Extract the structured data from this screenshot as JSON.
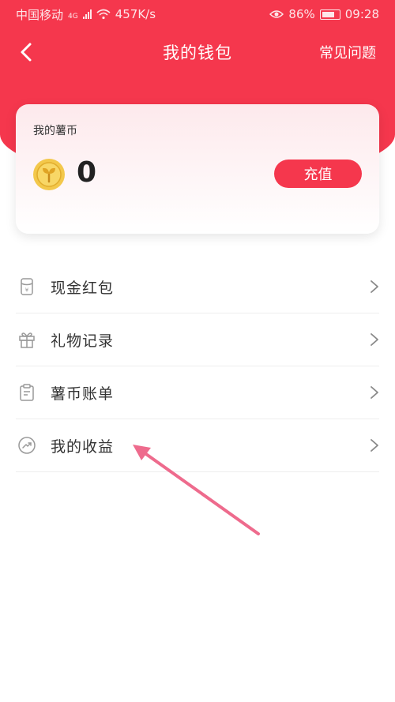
{
  "status_bar": {
    "carrier": "中国移动",
    "network": "4G",
    "speed": "457K/s",
    "battery": "86%",
    "time": "09:28"
  },
  "nav": {
    "title": "我的钱包",
    "faq_label": "常见问题"
  },
  "wallet": {
    "label": "我的薯币",
    "balance": "0",
    "recharge_label": "充值"
  },
  "menu": {
    "items": [
      {
        "label": "现金红包",
        "icon": "cash-envelope-icon"
      },
      {
        "label": "礼物记录",
        "icon": "gift-icon"
      },
      {
        "label": "薯币账单",
        "icon": "bill-icon"
      },
      {
        "label": "我的收益",
        "icon": "earnings-icon"
      }
    ]
  },
  "colors": {
    "brand": "#f5374d",
    "annotation": "#ee6b8d"
  }
}
